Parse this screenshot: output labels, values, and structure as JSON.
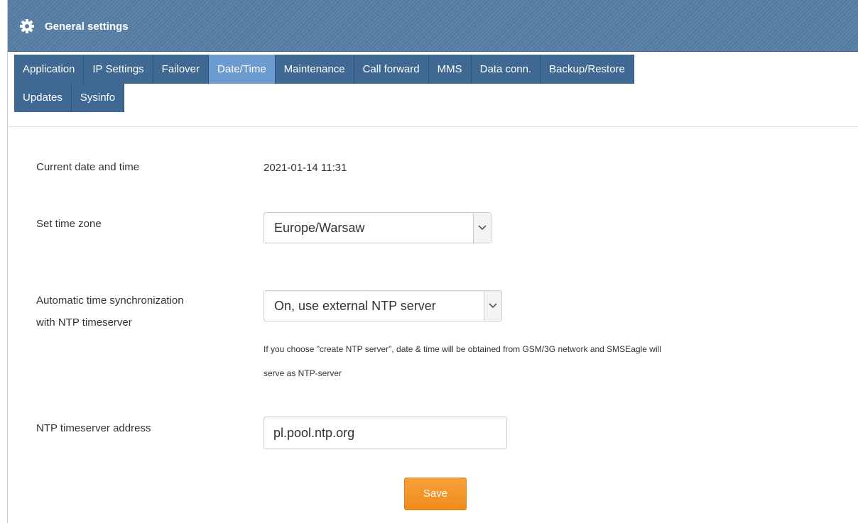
{
  "header": {
    "title": "General settings",
    "icon": "gear-icon"
  },
  "tabs": {
    "row1": [
      "Application",
      "IP Settings",
      "Failover",
      "Date/Time",
      "Maintenance",
      "Call forward",
      "MMS",
      "Data conn.",
      "Backup/Restore"
    ],
    "row2": [
      "Updates",
      "Sysinfo"
    ],
    "active": "Date/Time"
  },
  "form": {
    "current_label": "Current date and time",
    "current_value": "2021-01-14 11:31",
    "timezone_label": "Set time zone",
    "timezone_value": "Europe/Warsaw",
    "ntp_sync_label_line1": "Automatic time synchronization",
    "ntp_sync_label_line2": "with NTP timeserver",
    "ntp_sync_value": "On, use external NTP server",
    "ntp_hint_line1": "If you choose \"create NTP server\", date & time will be obtained from GSM/3G network and SMSEagle will",
    "ntp_hint_line2": "serve as NTP-server",
    "ntp_address_label": "NTP timeserver address",
    "ntp_address_value": "pl.pool.ntp.org",
    "save_label": "Save"
  },
  "colors": {
    "header": "#5d84ab",
    "tab": "#3f6993",
    "tab_active": "#6b9bcf",
    "save_button": "#f39a2c"
  }
}
